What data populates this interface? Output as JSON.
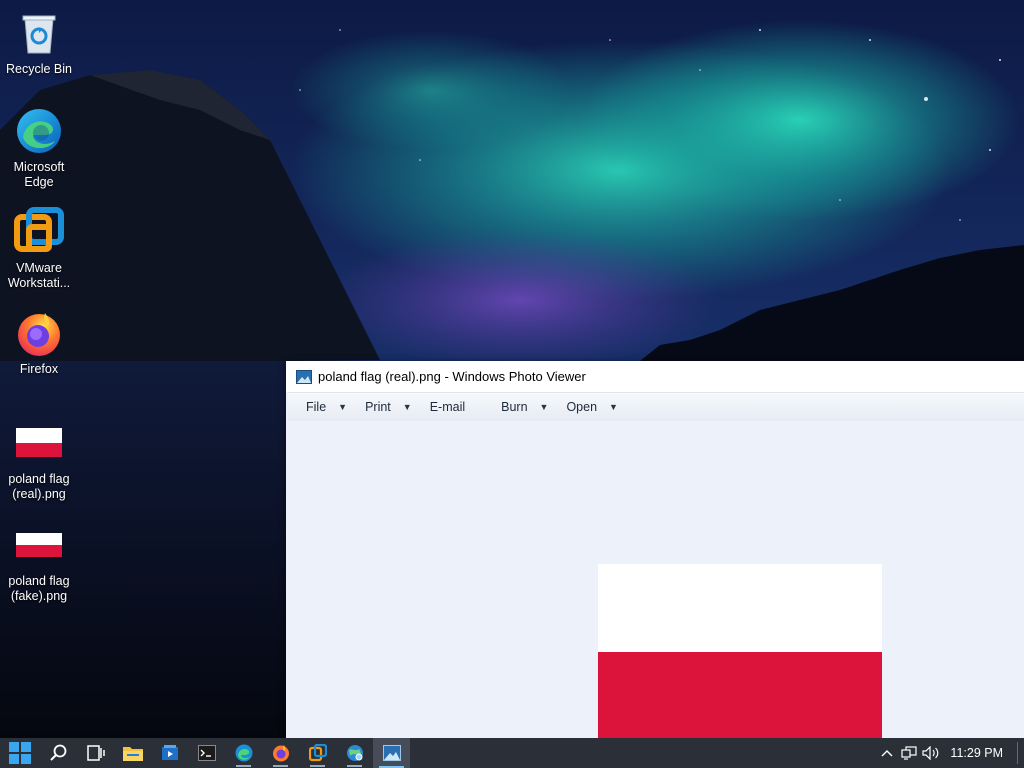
{
  "desktop": {
    "icons": [
      {
        "label": "Recycle Bin",
        "icon": "recycle-bin-icon"
      },
      {
        "label": "Microsoft\nEdge",
        "icon": "edge-icon"
      },
      {
        "label": "VMware\nWorkstati...",
        "icon": "vmware-icon"
      },
      {
        "label": "Firefox",
        "icon": "firefox-icon"
      },
      {
        "label": "poland flag\n(real).png",
        "icon": "png-file-icon"
      },
      {
        "label": "poland flag\n(fake).png",
        "icon": "png-file-icon"
      }
    ]
  },
  "window": {
    "title": "poland flag (real).png - Windows Photo Viewer",
    "menu": [
      {
        "label": "File",
        "has_arrow": true
      },
      {
        "label": "Print",
        "has_arrow": true
      },
      {
        "label": "E-mail",
        "has_arrow": false
      },
      {
        "label": "Burn",
        "has_arrow": true
      },
      {
        "label": "Open",
        "has_arrow": true
      }
    ],
    "image": {
      "top_color": "#ffffff",
      "bottom_color": "#dc143c"
    }
  },
  "taskbar": {
    "apps": [
      "start-icon",
      "search-icon",
      "task-view-icon",
      "file-explorer-icon",
      "media-player-icon",
      "terminal-icon",
      "edge-icon",
      "firefox-icon",
      "vmware-icon",
      "network-globe-icon",
      "photo-viewer-icon"
    ],
    "clock": "11:29 PM"
  },
  "colors": {
    "accent": "#0078d4",
    "flag_red": "#dc143c",
    "taskbar": "#2b2f38"
  }
}
